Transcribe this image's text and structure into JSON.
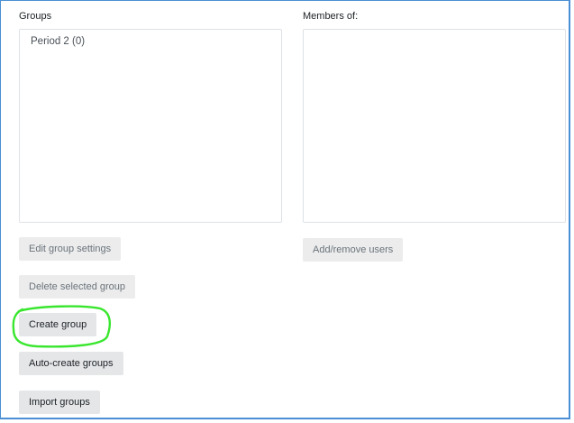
{
  "groups_panel": {
    "heading": "Groups",
    "options": [
      "Period 2 (0)"
    ]
  },
  "members_panel": {
    "heading": "Members of:"
  },
  "buttons": {
    "edit_group_settings": "Edit group settings",
    "delete_selected_group": "Delete selected group",
    "create_group": "Create group",
    "auto_create_groups": "Auto-create groups",
    "import_groups": "Import groups",
    "add_remove_users": "Add/remove users"
  },
  "annotation": {
    "highlight_color": "#39e62e"
  }
}
